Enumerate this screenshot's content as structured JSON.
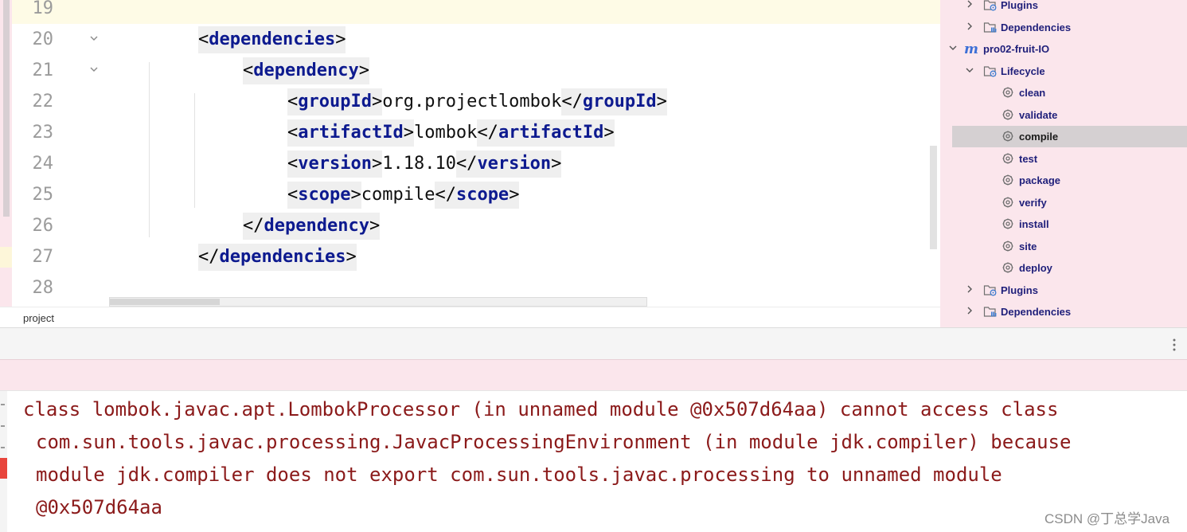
{
  "editor": {
    "lines": [
      {
        "num": "19",
        "segments": []
      },
      {
        "num": "20",
        "fold": true,
        "segments": [
          {
            "cls": "b",
            "t": "<"
          },
          {
            "cls": "n",
            "t": "dependencies"
          },
          {
            "cls": "b",
            "t": ">"
          }
        ]
      },
      {
        "num": "21",
        "fold": true,
        "segments": [
          {
            "cls": "b",
            "t": "<"
          },
          {
            "cls": "n",
            "t": "dependency"
          },
          {
            "cls": "b",
            "t": ">"
          }
        ]
      },
      {
        "num": "22",
        "segments": [
          {
            "cls": "b",
            "t": "<"
          },
          {
            "cls": "n",
            "t": "groupId"
          },
          {
            "cls": "b",
            "t": ">"
          },
          {
            "cls": "x",
            "t": "org.projectlombok"
          },
          {
            "cls": "b",
            "t": "</"
          },
          {
            "cls": "n",
            "t": "groupId"
          },
          {
            "cls": "b",
            "t": ">"
          }
        ]
      },
      {
        "num": "23",
        "segments": [
          {
            "cls": "b",
            "t": "<"
          },
          {
            "cls": "n",
            "t": "artifactId"
          },
          {
            "cls": "b",
            "t": ">"
          },
          {
            "cls": "x",
            "t": "lombok"
          },
          {
            "cls": "b",
            "t": "</"
          },
          {
            "cls": "n",
            "t": "artifactId"
          },
          {
            "cls": "b",
            "t": ">"
          }
        ]
      },
      {
        "num": "24",
        "segments": [
          {
            "cls": "b",
            "t": "<"
          },
          {
            "cls": "n",
            "t": "version"
          },
          {
            "cls": "b",
            "t": ">"
          },
          {
            "cls": "x",
            "t": "1.18.10"
          },
          {
            "cls": "b",
            "t": "</"
          },
          {
            "cls": "n",
            "t": "version"
          },
          {
            "cls": "b",
            "t": ">"
          }
        ]
      },
      {
        "num": "25",
        "segments": [
          {
            "cls": "b",
            "t": "<"
          },
          {
            "cls": "n",
            "t": "scope"
          },
          {
            "cls": "b",
            "t": ">"
          },
          {
            "cls": "x",
            "t": "compile"
          },
          {
            "cls": "b",
            "t": "</"
          },
          {
            "cls": "n",
            "t": "scope"
          },
          {
            "cls": "b",
            "t": ">"
          }
        ]
      },
      {
        "num": "26",
        "segments": [
          {
            "cls": "b",
            "t": "</"
          },
          {
            "cls": "n",
            "t": "dependency"
          },
          {
            "cls": "b",
            "t": ">"
          }
        ]
      },
      {
        "num": "27",
        "segments": [
          {
            "cls": "b",
            "t": "</"
          },
          {
            "cls": "n",
            "t": "dependencies"
          },
          {
            "cls": "b",
            "t": ">"
          }
        ]
      },
      {
        "num": "28",
        "segments": []
      }
    ]
  },
  "breadcrumb": "project",
  "maven": {
    "items": [
      {
        "label": "Plugins",
        "chevron": "right",
        "icon": "folder-gear",
        "key": "plugins-top"
      },
      {
        "label": "Dependencies",
        "chevron": "right",
        "icon": "folder-lib",
        "key": "dependencies-top"
      },
      {
        "label": "pro02-fruit-IO",
        "chevron": "down",
        "icon": "maven",
        "key": "project"
      },
      {
        "label": "Lifecycle",
        "chevron": "down",
        "icon": "folder-gear",
        "key": "lifecycle"
      },
      {
        "label": "clean",
        "icon": "gear",
        "key": "clean"
      },
      {
        "label": "validate",
        "icon": "gear",
        "key": "validate"
      },
      {
        "label": "compile",
        "icon": "gear",
        "key": "compile",
        "selected": true
      },
      {
        "label": "test",
        "icon": "gear",
        "key": "test"
      },
      {
        "label": "package",
        "icon": "gear",
        "key": "package"
      },
      {
        "label": "verify",
        "icon": "gear",
        "key": "verify"
      },
      {
        "label": "install",
        "icon": "gear",
        "key": "install"
      },
      {
        "label": "site",
        "icon": "gear",
        "key": "site"
      },
      {
        "label": "deploy",
        "icon": "gear",
        "key": "deploy"
      },
      {
        "label": "Plugins",
        "chevron": "right",
        "icon": "folder-gear",
        "key": "plugins"
      },
      {
        "label": "Dependencies",
        "chevron": "right",
        "icon": "folder-lib",
        "key": "dependencies"
      }
    ]
  },
  "console": {
    "lines": [
      "class lombok.javac.apt.LombokProcessor (in unnamed module @0x507d64aa) cannot access class",
      "com.sun.tools.javac.processing.JavacProcessingEnvironment (in module jdk.compiler) because",
      "module jdk.compiler does not export com.sun.tools.javac.processing to unnamed module",
      "@0x507d64aa"
    ]
  },
  "watermark": "CSDN @丁总学Java",
  "colors": {
    "accent": "#0d1a8f",
    "error": "#8b1a1a",
    "panel": "#fbe6ec"
  }
}
